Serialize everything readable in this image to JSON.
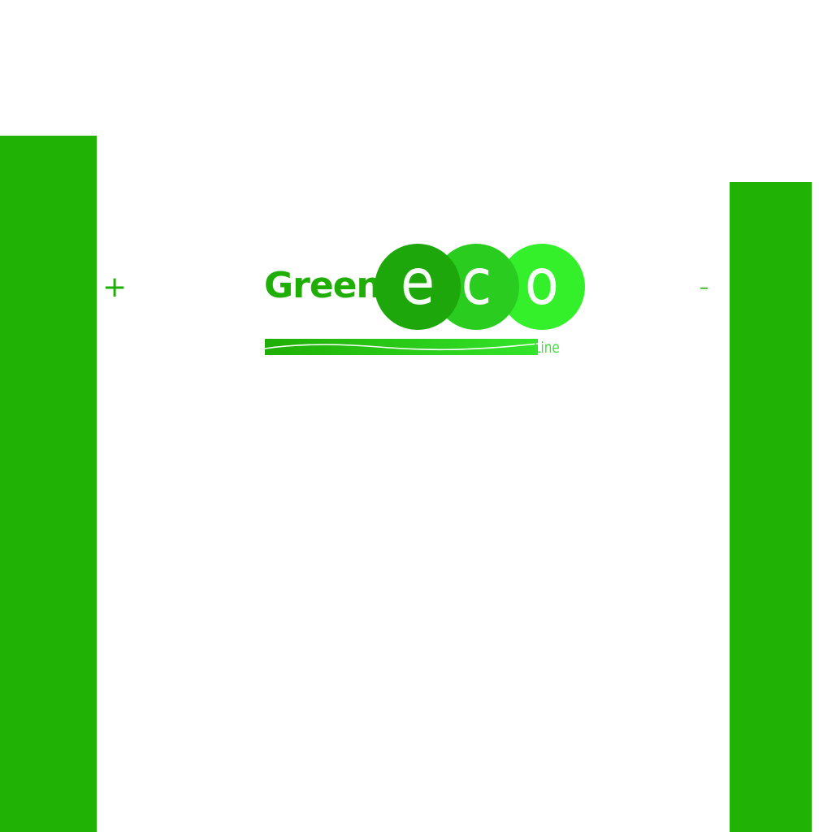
{
  "colors": {
    "panel": "#20b205",
    "accent": "#1fae05",
    "circle_1": "#1ea70a",
    "circle_2": "#29cc1f",
    "circle_3": "#33f02a",
    "bar": "#1fb311",
    "subtitle": "#3ee03a",
    "background": "#ffffff"
  },
  "marks": {
    "plus": "+",
    "minus": "–"
  },
  "logo": {
    "word": "Green",
    "letters": [
      "e",
      "c",
      "o"
    ],
    "subtitle": "Line"
  }
}
